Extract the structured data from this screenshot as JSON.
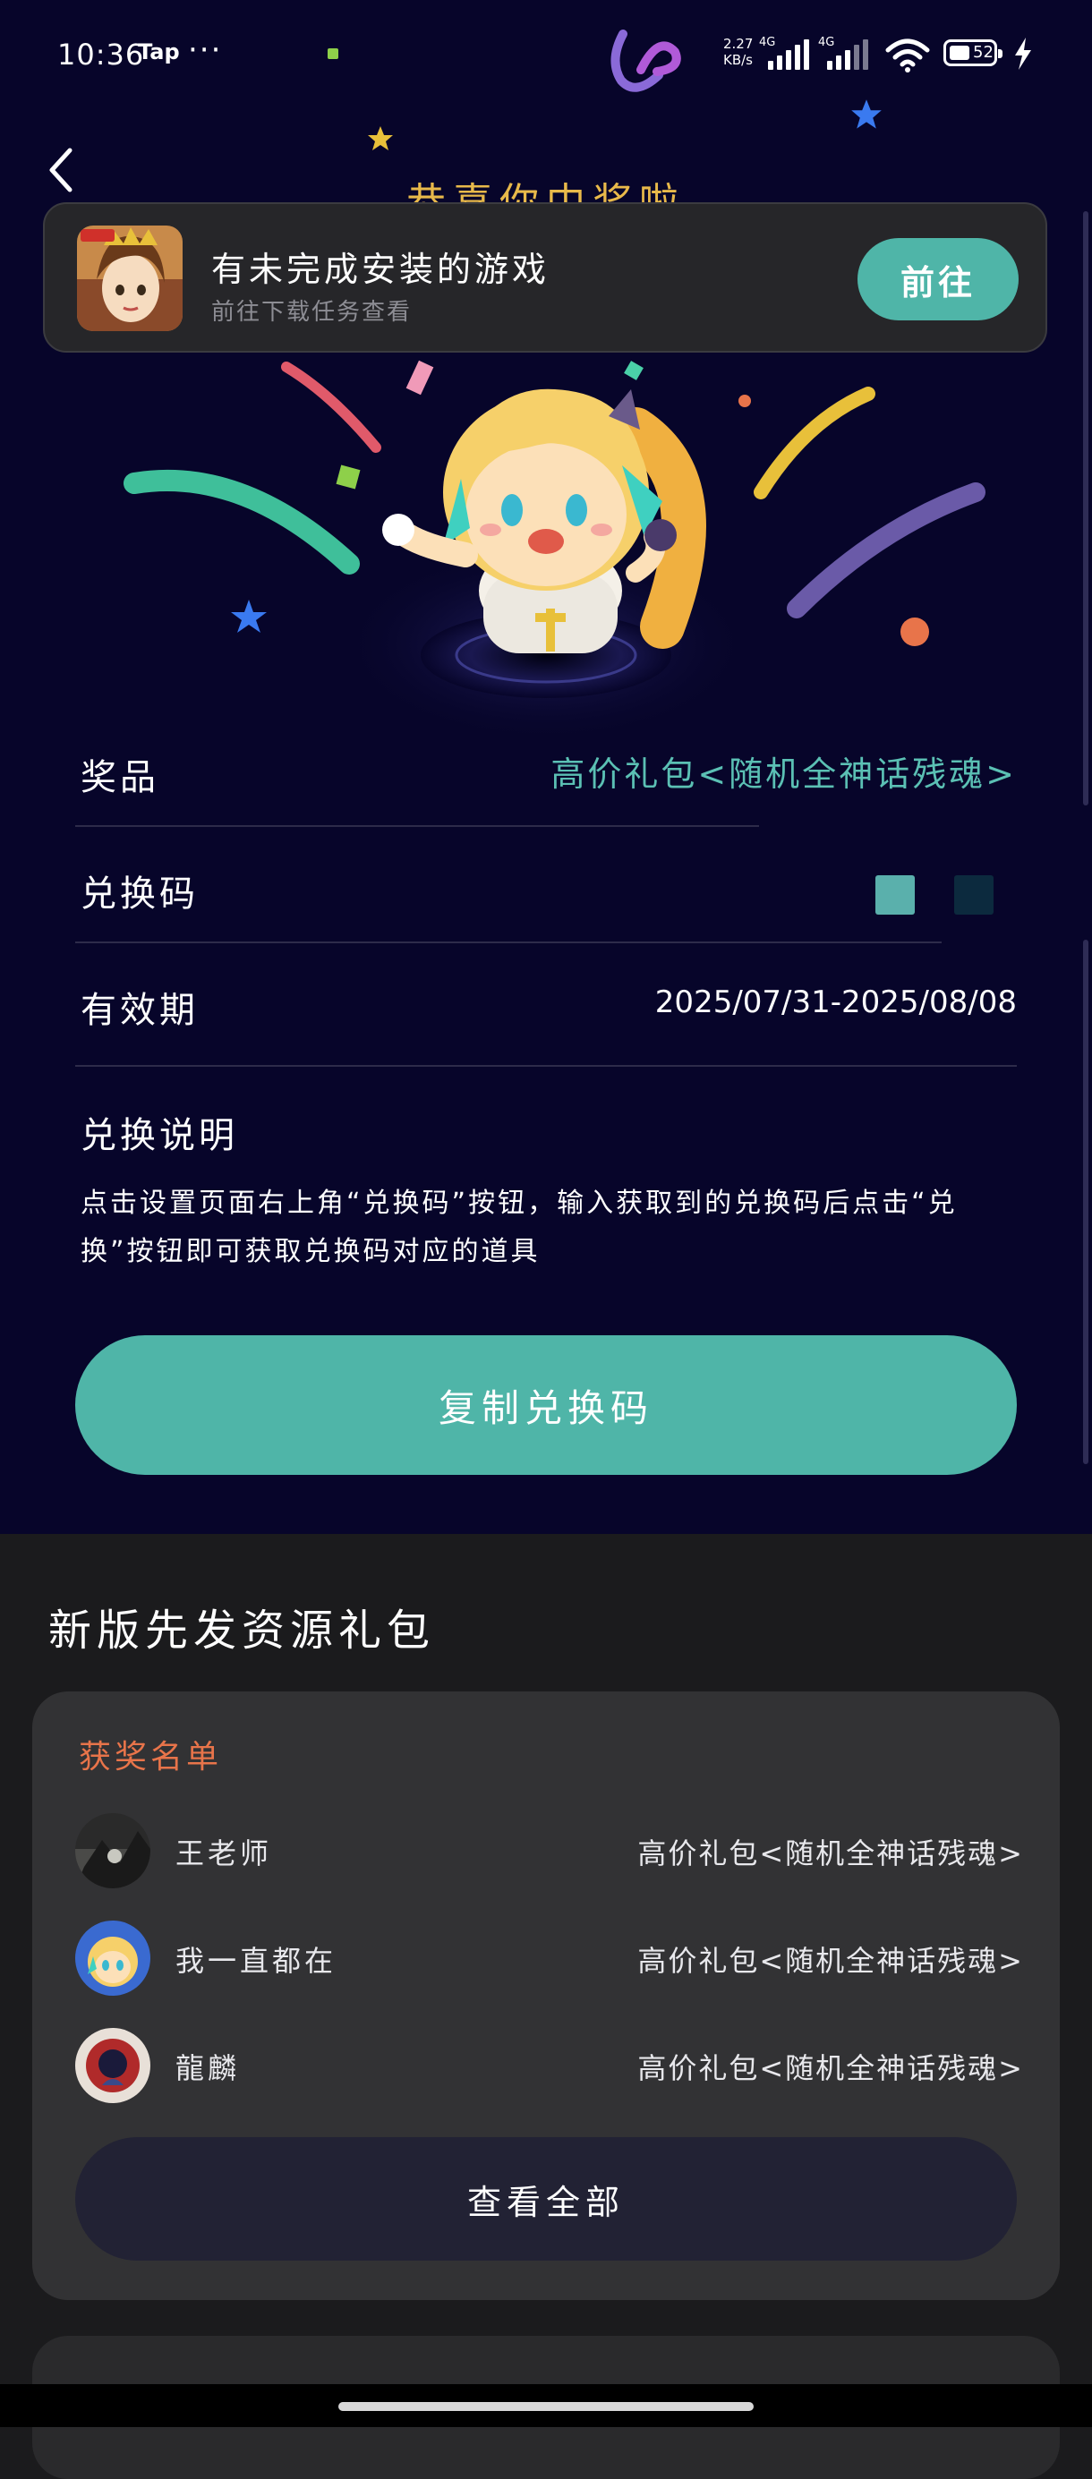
{
  "status_bar": {
    "time": "10:36",
    "app": "Tap",
    "more": "···",
    "speed_value": "2.27",
    "speed_unit": "KB/s",
    "sim1": "4G",
    "sim2": "4G",
    "battery": "52"
  },
  "header": {
    "banner_title": "恭喜你中奖啦"
  },
  "install_notice": {
    "title": "有未完成安装的游戏",
    "subtitle": "前往下载任务查看",
    "button_label": "前往"
  },
  "reward": {
    "prize_label": "奖品",
    "prize_value": "高价礼包<随机全神话残魂>",
    "code_label": "兑换码",
    "validity_label": "有效期",
    "validity_value": "2025/07/31-2025/08/08",
    "instructions_label": "兑换说明",
    "instructions_text": "点击设置页面右上角“兑换码”按钮，输入获取到的兑换码后点击“兑换”按钮即可获取兑换码对应的道具",
    "copy_button": "复制兑换码"
  },
  "gift_section": {
    "title": "新版先发资源礼包",
    "winners_title": "获奖名单",
    "winners": [
      {
        "name": "王老师",
        "prize": "高价礼包<随机全神话残魂>"
      },
      {
        "name": "我一直都在",
        "prize": "高价礼包<随机全神话残魂>"
      },
      {
        "name": "龍麟",
        "prize": "高价礼包<随机全神话残魂>"
      }
    ],
    "view_all": "查看全部"
  },
  "colors": {
    "hero_bg": "#07052a",
    "accent_teal": "#4fb5a8",
    "prize_text": "#5bc0b4",
    "winners_title": "#e8744a",
    "banner_gold": "#e8b94a"
  },
  "icons": [
    "back-icon",
    "wifi-icon",
    "battery-icon",
    "charging-icon",
    "signal-icon"
  ]
}
